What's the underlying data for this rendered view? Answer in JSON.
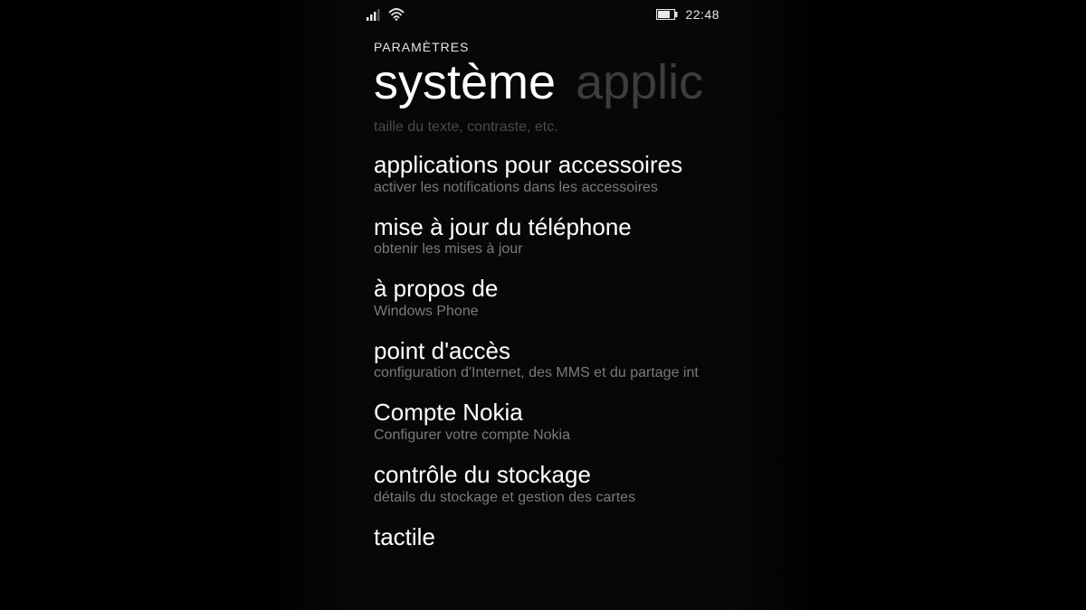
{
  "statusbar": {
    "time": "22:48"
  },
  "header": {
    "breadcrumb": "PARAMÈTRES",
    "pivot_active": "système",
    "pivot_inactive": "applic"
  },
  "partial_item_sub": "taille du texte, contraste, etc.",
  "items": [
    {
      "title": "applications pour accessoires",
      "sub": "activer les notifications dans les accessoires"
    },
    {
      "title": "mise à jour du téléphone",
      "sub": "obtenir les mises à jour"
    },
    {
      "title": "à propos de",
      "sub": "Windows Phone"
    },
    {
      "title": "point d'accès",
      "sub": "configuration d'Internet, des MMS et du partage int"
    },
    {
      "title": "Compte Nokia",
      "sub": "Configurer votre compte Nokia"
    },
    {
      "title": "contrôle du stockage",
      "sub": "détails du stockage et gestion des cartes"
    },
    {
      "title": "tactile",
      "sub": ""
    }
  ]
}
